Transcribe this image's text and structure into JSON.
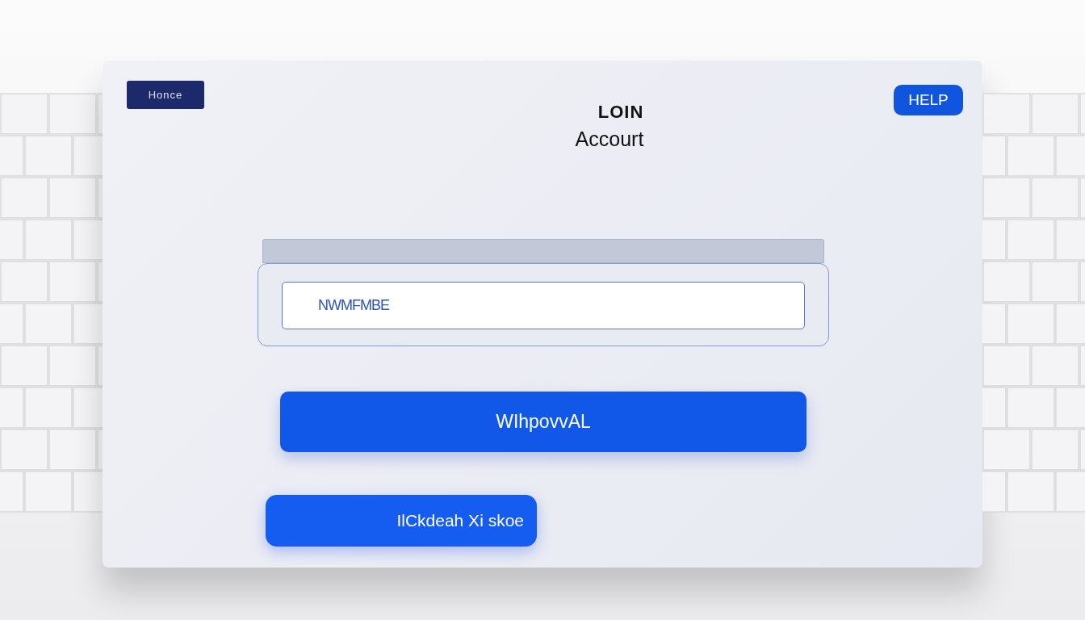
{
  "nav_button": "Honce",
  "help_button": "HELP",
  "title": "LOIN",
  "subtitle": "Accourt",
  "username_field": {
    "value": "NWMFMBE"
  },
  "primary_button": "WIhpovvAL",
  "secondary_button": "IlCkdeah Xi skoe"
}
